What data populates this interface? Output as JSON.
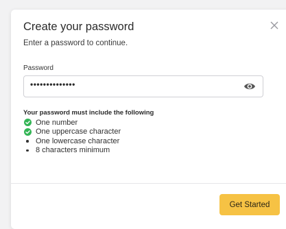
{
  "dialog": {
    "title": "Create your password",
    "subtitle": "Enter a password to continue.",
    "close_icon": "close-icon"
  },
  "password_field": {
    "label": "Password",
    "masked_value": "••••••••••••••",
    "visibility_icon": "eye-icon"
  },
  "requirements": {
    "heading": "Your password must include the following",
    "items": [
      {
        "label": "One number",
        "met": true
      },
      {
        "label": "One uppercase character",
        "met": true
      },
      {
        "label": "One lowercase character",
        "met": false
      },
      {
        "label": "8 characters minimum",
        "met": false
      }
    ]
  },
  "footer": {
    "submit_label": "Get Started"
  },
  "colors": {
    "accent": "#f6c244",
    "success": "#34b556"
  }
}
